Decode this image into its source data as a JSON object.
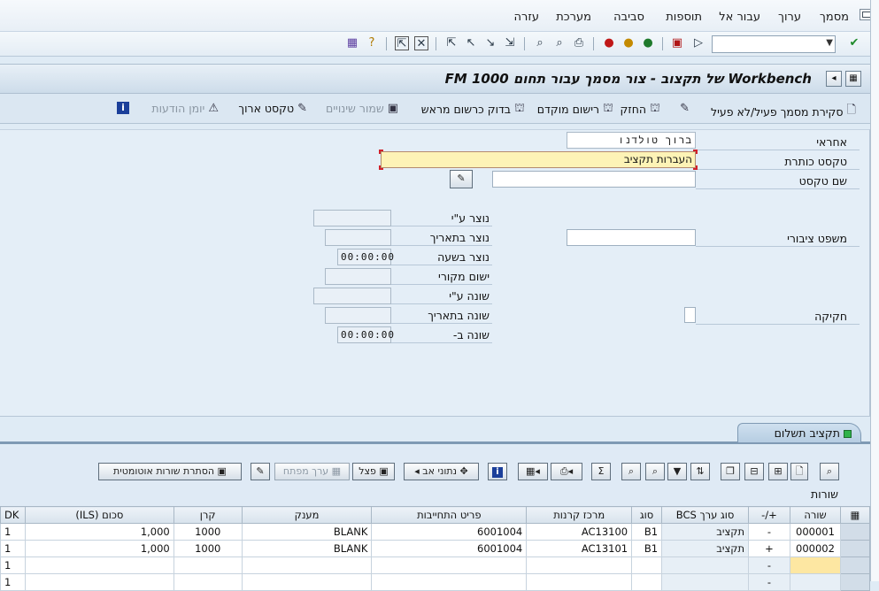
{
  "menu": [
    "מסמך",
    "ערוך",
    "עבור אל",
    "תוספות",
    "סביבה",
    "מערכת",
    "עזרה"
  ],
  "header": {
    "title": "Workbench של תקצוב - צור מסמך עבור תחום FM 1000"
  },
  "app_toolbar": {
    "close_doc": "סקירת מסמך פעיל/לא פעיל",
    "hold": "החזק",
    "prepost": "רישום מוקדם",
    "check_prepost": "בדוק כרשום מראש",
    "save_changes": "שמור שינויים",
    "long_text": "טקסט ארוך",
    "msg_log": "יומן הודעות"
  },
  "form": {
    "responsible_label": "אחראי",
    "responsible_value": "ברוך טולדנו",
    "title_text_label": "טקסט כותרת",
    "title_text_value": "העברות תקציב",
    "text_name_label": "שם טקסט",
    "text_name_value": "",
    "public_law_label": "משפט ציבורי",
    "public_law_value": "",
    "legislation_label": "חקיקה",
    "created_by_label": "נוצר ע\"י",
    "created_on_label": "נוצר בתאריך",
    "created_at_label": "נוצר בשעה",
    "created_at_value": "00:00:00",
    "orig_app_label": "ישום מקורי",
    "changed_by_label": "שונה ע\"י",
    "changed_on_label": "שונה בתאריך",
    "changed_at_label": "שונה ב-",
    "changed_at_value": "00:00:00"
  },
  "tab": {
    "label": "תקציב תשלום"
  },
  "grid_toolbar": {
    "auto_hide": "הסתרת שורות אוטומטית",
    "split": "פצל",
    "key_value": "ערך מפתח",
    "parent_data": "נתוני אב"
  },
  "grid": {
    "caption": "שורות",
    "columns": {
      "line": "שורה",
      "sign": "+/-",
      "bcs_type": "סוג ערך BCS",
      "type": "סוג",
      "fund_center": "מרכז קרנות",
      "commit_item": "פריט התחייבות",
      "grant": "מענק",
      "fund": "קרן",
      "amount": "סכום (ILS)",
      "dk": "DK"
    },
    "rows": [
      {
        "line": "000001",
        "sign": "-",
        "bcs_type": "תקציב",
        "type": "B1",
        "fund_center": "AC13100",
        "commit_item": "6001004",
        "grant": "BLANK",
        "fund": "1000",
        "amount": "1,000",
        "dk": "1"
      },
      {
        "line": "000002",
        "sign": "+",
        "bcs_type": "תקציב",
        "type": "B1",
        "fund_center": "AC13101",
        "commit_item": "6001004",
        "grant": "BLANK",
        "fund": "1000",
        "amount": "1,000",
        "dk": "1"
      },
      {
        "line": "",
        "sign": "-",
        "bcs_type": "",
        "type": "",
        "fund_center": "",
        "commit_item": "",
        "grant": "",
        "fund": "",
        "amount": "",
        "dk": "1"
      },
      {
        "line": "",
        "sign": "-",
        "bcs_type": "",
        "type": "",
        "fund_center": "",
        "commit_item": "",
        "grant": "",
        "fund": "",
        "amount": "",
        "dk": "1"
      }
    ]
  }
}
